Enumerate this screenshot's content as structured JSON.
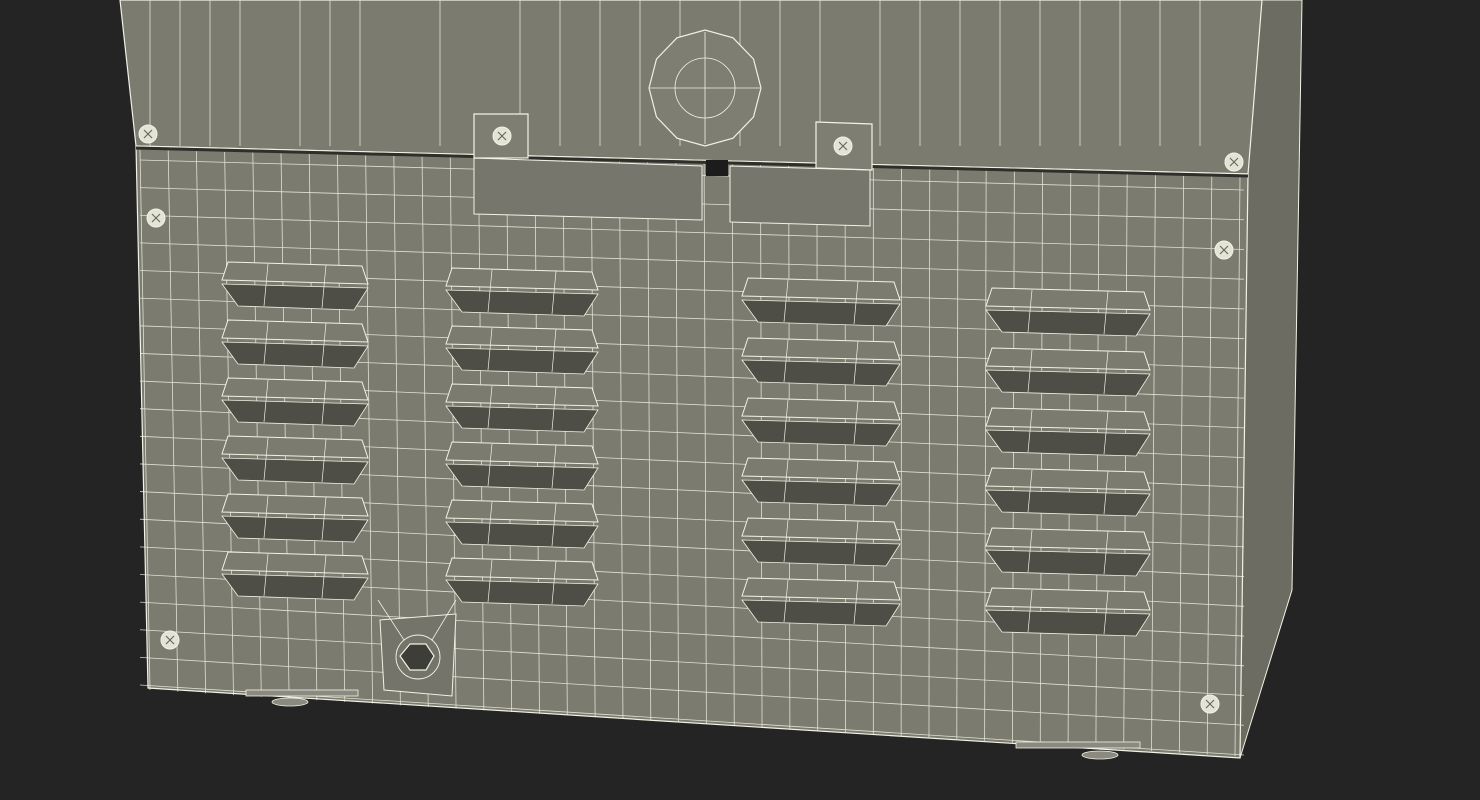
{
  "scene": {
    "subject": "appliance-rear-panel-wireframe",
    "background_color": "#242424",
    "panel_color": "#7b7b70",
    "panel_dark_color": "#6c6c62",
    "wire_color": "#f2f2e4",
    "shadow_color": "#4e4e46",
    "vent_columns": 4,
    "vents_per_column": 6,
    "screw_count": 8,
    "icons": [
      "screw-icon",
      "round-port-icon",
      "drain-fitting-icon",
      "vent-louver-icon"
    ]
  }
}
